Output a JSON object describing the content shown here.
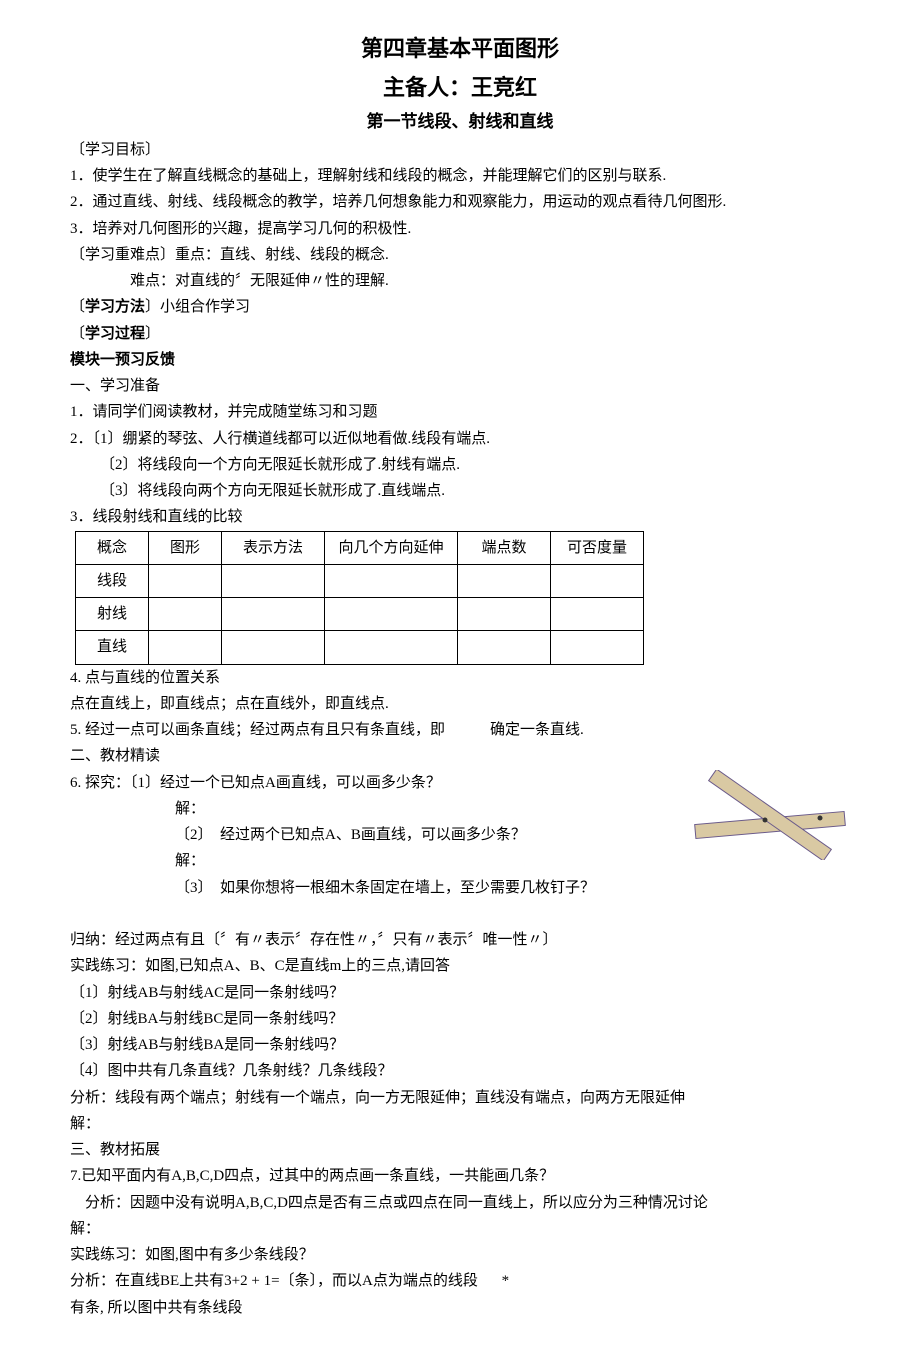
{
  "chapter_title": "第四章基本平面图形",
  "author_line": "主备人：王竞红",
  "section_title": "第一节线段、射线和直线",
  "heading_objectives": "〔学习目标〕",
  "obj1": "1．使学生在了解直线概念的基础上，理解射线和线段的概念，并能理解它们的区别与联系.",
  "obj2": "2．通过直线、射线、线段概念的教学，培养几何想象能力和观察能力，用运动的观点看待几何图形.",
  "obj3": "3．培养对几何图形的兴趣，提高学习几何的积极性.",
  "keypoints_label": "〔学习重难点〕重点：直线、射线、线段的概念.",
  "keypoints_hard": "难点：对直线的〞无限延伸〃性的理解.",
  "method_label": "〔",
  "method_bold": "学习方法",
  "method_tail": "〕小组合作学习",
  "process_label": "〔",
  "process_bold": "学习过程",
  "process_tail": "〕",
  "module1": "模块一预习反馈",
  "prep_heading": "一、学习准备",
  "prep1": "1．请同学们阅读教材，并完成随堂练习和习题",
  "prep2": "2．〔1〕绷紧的琴弦、人行横道线都可以近似地看做.线段有端点.",
  "prep2_2": "〔2〕将线段向一个方向无限延长就形成了.射线有端点.",
  "prep2_3": "〔3〕将线段向两个方向无限延长就形成了.直线端点.",
  "prep3": "3．线段射线和直线的比较",
  "table": {
    "h0": "概念",
    "h1": "图形",
    "h2": "表示方法",
    "h3": "向几个方向延伸",
    "h4": "端点数",
    "h5": "可否度量",
    "r1": "线段",
    "r2": "射线",
    "r3": "直线"
  },
  "item4": "4. 点与直线的位置关系",
  "item4_detail": "点在直线上，即直线点；点在直线外，即直线点.",
  "item5": "5. 经过一点可以画条直线；经过两点有且只有条直线，即　　　确定一条直线.",
  "reading_heading": "二、教材精读",
  "item6": "6. 探究：〔1〕经过一个已知点A画直线，可以画多少条？",
  "solve": "解：",
  "item6_2a": "〔2〕",
  "item6_2b": "经过两个已知点A、B画直线，可以画多少条？",
  "item6_3a": "〔3〕",
  "item6_3b": "如果你想将一根细木条固定在墙上，至少需要几枚钉子？",
  "induction": "归纳：经过两点有且〔〞有〃表示〞存在性〃，〞只有〃表示〞唯一性〃〕",
  "practice_intro": "  实践练习：如图,已知点A、B、C是直线m上的三点,请回答",
  "q1": "〔1〕射线AB与射线AC是同一条射线吗？",
  "q2": "〔2〕射线BA与射线BC是同一条射线吗？",
  "q3": "〔3〕射线AB与射线BA是同一条射线吗？",
  "q4": "〔4〕图中共有几条直线？几条射线？几条线段？",
  "analysis1": "  分析：线段有两个端点；射线有一个端点，向一方无限延伸；直线没有端点，向两方无限延伸",
  "solve2": "解：",
  "expand_heading": "三、教材拓展",
  "item7": "7.已知平面内有A,B,C,D四点，过其中的两点画一条直线，一共能画几条？",
  "analysis2": "　分析：因题中没有说明A,B,C,D四点是否有三点或四点在同一直线上，所以应分为三种情况讨论",
  "practice2": "实践练习：如图,图中有多少条线段？",
  "analysis3_a": "分析：在直线BE上共有3+2 + 1=〔条〕，而以A点为端点的线段",
  "analysis3_star": "*",
  "analysis3_b": "有条, 所以图中共有条线段"
}
